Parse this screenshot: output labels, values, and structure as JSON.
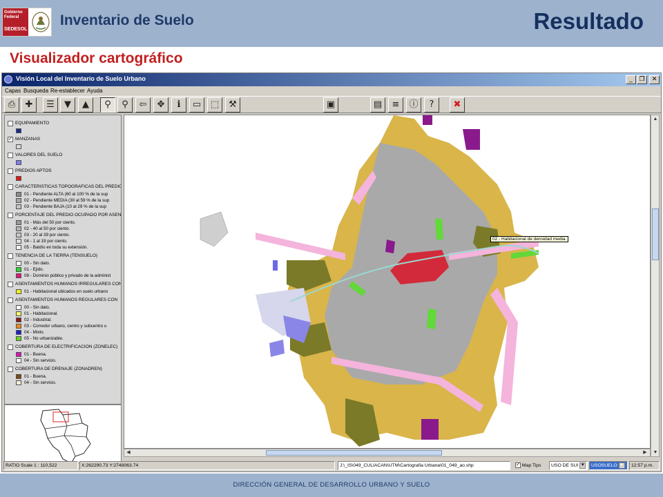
{
  "header": {
    "logo_line1": "Gobierno Federal",
    "logo_line2": "SEDESOL",
    "subtitle": "Inventario de Suelo",
    "title": "Resultado"
  },
  "section_title": "Visualizador cartográfico",
  "app": {
    "title": "Visión Local del Inventario de Suelo Urbano",
    "controls": {
      "minimize": "_",
      "maximize": "❐",
      "close": "✕"
    },
    "menu": [
      "Capas",
      "Busqueda",
      "Re-establecer",
      "Ayuda"
    ],
    "toolbar_icons": [
      "print-icon",
      "add-layer-icon",
      "table-icon",
      "layer-down-icon",
      "layer-up-icon",
      "zoom-in-icon",
      "zoom-out-icon",
      "back-icon",
      "pan-icon",
      "identify-icon",
      "measure-icon",
      "select-icon",
      "tool-icon",
      "save-icon",
      "report-icon",
      "info-stack-icon",
      "info-doc-icon",
      "help-icon",
      "close-red-icon"
    ]
  },
  "legend": [
    {
      "title": "EQUIPAMIENTO",
      "checked": false,
      "items": [
        {
          "color": "#1c2a8c",
          "label": ""
        }
      ]
    },
    {
      "title": "MANZANAS",
      "checked": true,
      "items": [
        {
          "color": "#d8d8d8",
          "label": ""
        }
      ]
    },
    {
      "title": "VALORES DEL SUELO",
      "checked": false,
      "items": [
        {
          "color": "#7b7cf0",
          "label": ""
        }
      ]
    },
    {
      "title": "PREDIOS APTOS",
      "checked": false,
      "items": [
        {
          "color": "#e01818",
          "label": ""
        }
      ]
    },
    {
      "title": "CARACTERISTICAS TOPOGRAFICAS DEL PREDIO",
      "checked": false,
      "items": [
        {
          "color": "#8c8c8c",
          "label": "01 - Pendiente ALTA (60 al 100 % de la sup"
        },
        {
          "color": "#a8a8a8",
          "label": "02 - Pendiente MEDIA (30 al 59 % de la sup"
        },
        {
          "color": "#c4c4c4",
          "label": "03 - Pendiente BAJA (10 al 29 % de la sup"
        }
      ]
    },
    {
      "title": "PORCENTAJE DEL PREDIO OCUPADO POR ASENTAMIENTOS",
      "checked": false,
      "items": [
        {
          "color": "#9a9a9a",
          "label": "01 - Más del 50 por ciento."
        },
        {
          "color": "#b4b4b4",
          "label": "02 - 40 al 50 por ciento."
        },
        {
          "color": "#c8c8c8",
          "label": "03 - 20 al 39 por ciento."
        },
        {
          "color": "#dedede",
          "label": "04 - 1 al 19 por ciento."
        },
        {
          "color": "#f2f2f2",
          "label": "05 - Baldío en toda su extensión."
        }
      ]
    },
    {
      "title": "TENENCIA DE LA TIERRA (TENSUELO)",
      "checked": false,
      "items": [
        {
          "color": "#ffffff",
          "label": "00 - Sin dato."
        },
        {
          "color": "#2cd62c",
          "label": "01 - Ejido."
        },
        {
          "color": "#e0187a",
          "label": "08 - Dominio público y privado de la administ"
        }
      ]
    },
    {
      "title": "ASENTAMIENTOS HUMANOS IRREGULARES CON",
      "checked": false,
      "items": [
        {
          "color": "#f0f020",
          "label": "01 - Habitacional ubicados en suelo urbano"
        }
      ]
    },
    {
      "title": "ASENTAMIENTOS HUMANOS REGULARES CON",
      "checked": false,
      "items": [
        {
          "color": "#ffffff",
          "label": "00 - Sin dato."
        },
        {
          "color": "#f2f26a",
          "label": "01 - Habitacional."
        },
        {
          "color": "#8a1a1a",
          "label": "02 - Industrial."
        },
        {
          "color": "#f08a1c",
          "label": "03 - Corredor urbano, centro y subcentro u"
        },
        {
          "color": "#1c20c8",
          "label": "04 - Mixto."
        },
        {
          "color": "#6ad41c",
          "label": "05 - No urbanizable."
        }
      ]
    },
    {
      "title": "COBERTURA DE ELECTRIFICACION (ZONELEC)",
      "checked": false,
      "items": [
        {
          "color": "#d418b4",
          "label": "01 - Buena."
        },
        {
          "color": "#ffffff",
          "label": "04 - Sin servicio."
        }
      ]
    },
    {
      "title": "COBERTURA DE DRENAJE (ZONADREN)",
      "checked": false,
      "items": [
        {
          "color": "#7a4a1a",
          "label": "01 - Buena."
        },
        {
          "color": "#f4e8d4",
          "label": "04 - Sin servicio."
        }
      ]
    }
  ],
  "map": {
    "tooltip": "02 - Habitacional de densidad media."
  },
  "status": {
    "ratio": "RATIO Scale 1 : 110,522",
    "coords": "X:262290.73 Y:2748063.74",
    "path": "J:\\_IS\\049_CULIACAN\\UTM\\Cartografia Urbana\\01_049_ao.shp",
    "map_tips": "Map Tips",
    "map_tips_checked": true,
    "select1": "USO DE SUI",
    "select2": "USOSUELO",
    "time": "12:57 p.m."
  },
  "footer": "DIRECCIÓN GENERAL DE DESARROLLO URBANO Y SUELO"
}
